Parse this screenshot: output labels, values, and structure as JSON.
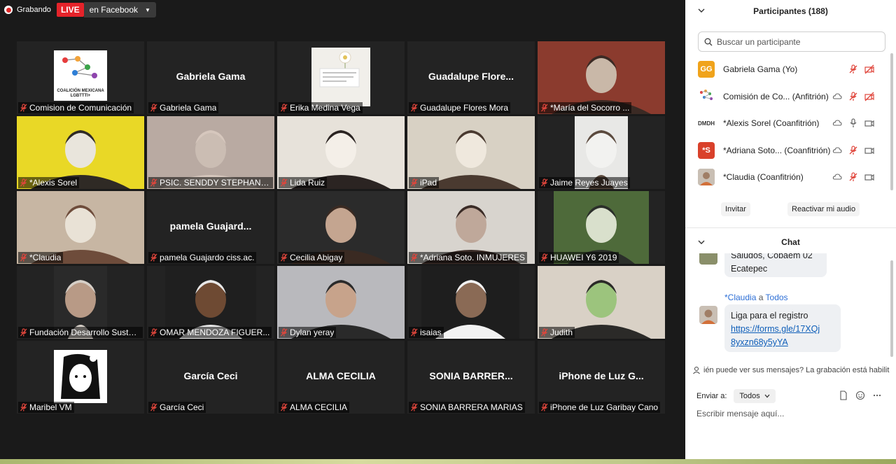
{
  "topbar": {
    "recording_label": "Grabando",
    "live_label": "LIVE",
    "stream_target": "en Facebook"
  },
  "tiles": [
    {
      "caption": "Comision de Comunicación",
      "big_name": "",
      "kind": "logo",
      "logo_text": "COALICIÓN MEXICANA LGBTTTI+"
    },
    {
      "caption": "Gabriela Gama",
      "big_name": "Gabriela Gama",
      "kind": "name"
    },
    {
      "caption": "Erika Medina Vega",
      "big_name": "",
      "kind": "image"
    },
    {
      "caption": "Guadalupe Flores Mora",
      "big_name": "Guadalupe  Flore...",
      "kind": "name"
    },
    {
      "caption": "*María del Socorro ...",
      "big_name": "",
      "kind": "video"
    },
    {
      "caption": "*Alexis Sorel",
      "big_name": "",
      "kind": "video",
      "active": true
    },
    {
      "caption": "PSIC. SENDDY STEPHANYA ...",
      "big_name": "",
      "kind": "video"
    },
    {
      "caption": "Lida Ruiz",
      "big_name": "",
      "kind": "video"
    },
    {
      "caption": "iPad",
      "big_name": "",
      "kind": "video"
    },
    {
      "caption": "Jaime Reyes Juayes",
      "big_name": "",
      "kind": "video"
    },
    {
      "caption": "*Claudia",
      "big_name": "",
      "kind": "video"
    },
    {
      "caption": "pamela Guajardo ciss.ac.",
      "big_name": "pamela  Guajard...",
      "kind": "name"
    },
    {
      "caption": "Cecilia Abigay",
      "big_name": "",
      "kind": "video"
    },
    {
      "caption": "*Adriana Soto. INMUJERES",
      "big_name": "",
      "kind": "video"
    },
    {
      "caption": "HUAWEI Y6 2019",
      "big_name": "",
      "kind": "video"
    },
    {
      "caption": "Fundación Desarrollo Sustent...",
      "big_name": "",
      "kind": "video"
    },
    {
      "caption": "OMAR MENDOZA FIGUER...",
      "big_name": "",
      "kind": "video"
    },
    {
      "caption": "Dylan yeray",
      "big_name": "",
      "kind": "video"
    },
    {
      "caption": "isaias",
      "big_name": "",
      "kind": "video"
    },
    {
      "caption": "Judith",
      "big_name": "",
      "kind": "video"
    },
    {
      "caption": "Maribel VM",
      "big_name": "",
      "kind": "image"
    },
    {
      "caption": "García Ceci",
      "big_name": "García Ceci",
      "kind": "name"
    },
    {
      "caption": "ALMA CECILIA",
      "big_name": "ALMA CECILIA",
      "kind": "name"
    },
    {
      "caption": "SONIA BARRERA MARIAS",
      "big_name": "SONIA  BARRER...",
      "kind": "name"
    },
    {
      "caption": "iPhone de Luz Garibay Cano",
      "big_name": "iPhone de Luz G...",
      "kind": "name"
    }
  ],
  "participants_panel": {
    "title": "Participantes (188)",
    "search_placeholder": "Buscar un participante",
    "list": [
      {
        "name": "Gabriela Gama (Yo)",
        "avatar_text": "GG",
        "avatar_color": "#f0a31b"
      },
      {
        "name": "Comisión de Co...  (Anfitrión)",
        "avatar_text": "",
        "avatar_color": "#ffffff"
      },
      {
        "name": "*Alexis Sorel (Coanfitrión)",
        "avatar_text": "DMDH",
        "avatar_color": "#ffffff"
      },
      {
        "name": "*Adriana Soto...  (Coanfitrión)",
        "avatar_text": "*S",
        "avatar_color": "#d9412b"
      },
      {
        "name": "*Claudia (Coanfitrión)",
        "avatar_text": "",
        "avatar_color": "#b9a99a"
      }
    ],
    "invite_label": "Invitar",
    "unmute_label": "Reactivar mi audio"
  },
  "chat_panel": {
    "title": "Chat",
    "prev_message_line1": "Saludos, Cobaem 02",
    "prev_message_line2": "Ecatepec",
    "sender": "*Claudia",
    "to_word": "a",
    "recipient": "Todos",
    "message_text": "Liga para el registro",
    "message_link_line1": "https://forms.gle/17XQj",
    "message_link_line2": "8yxzn68y5yYA",
    "notice": "ién puede ver sus mensajes? La grabación está habilit",
    "send_to_label": "Enviar a:",
    "send_to_value": "Todos",
    "input_placeholder": "Escribir mensaje aquí..."
  },
  "colors": {
    "gallery_bg": "#1a1a1a",
    "tile_bg": "#232323",
    "active_speaker": "#e8e231",
    "live_red": "#e5232a",
    "mic_off_red": "#e0463c",
    "link_blue": "#0e5eb9",
    "host_blue": "#2d6fd6"
  }
}
